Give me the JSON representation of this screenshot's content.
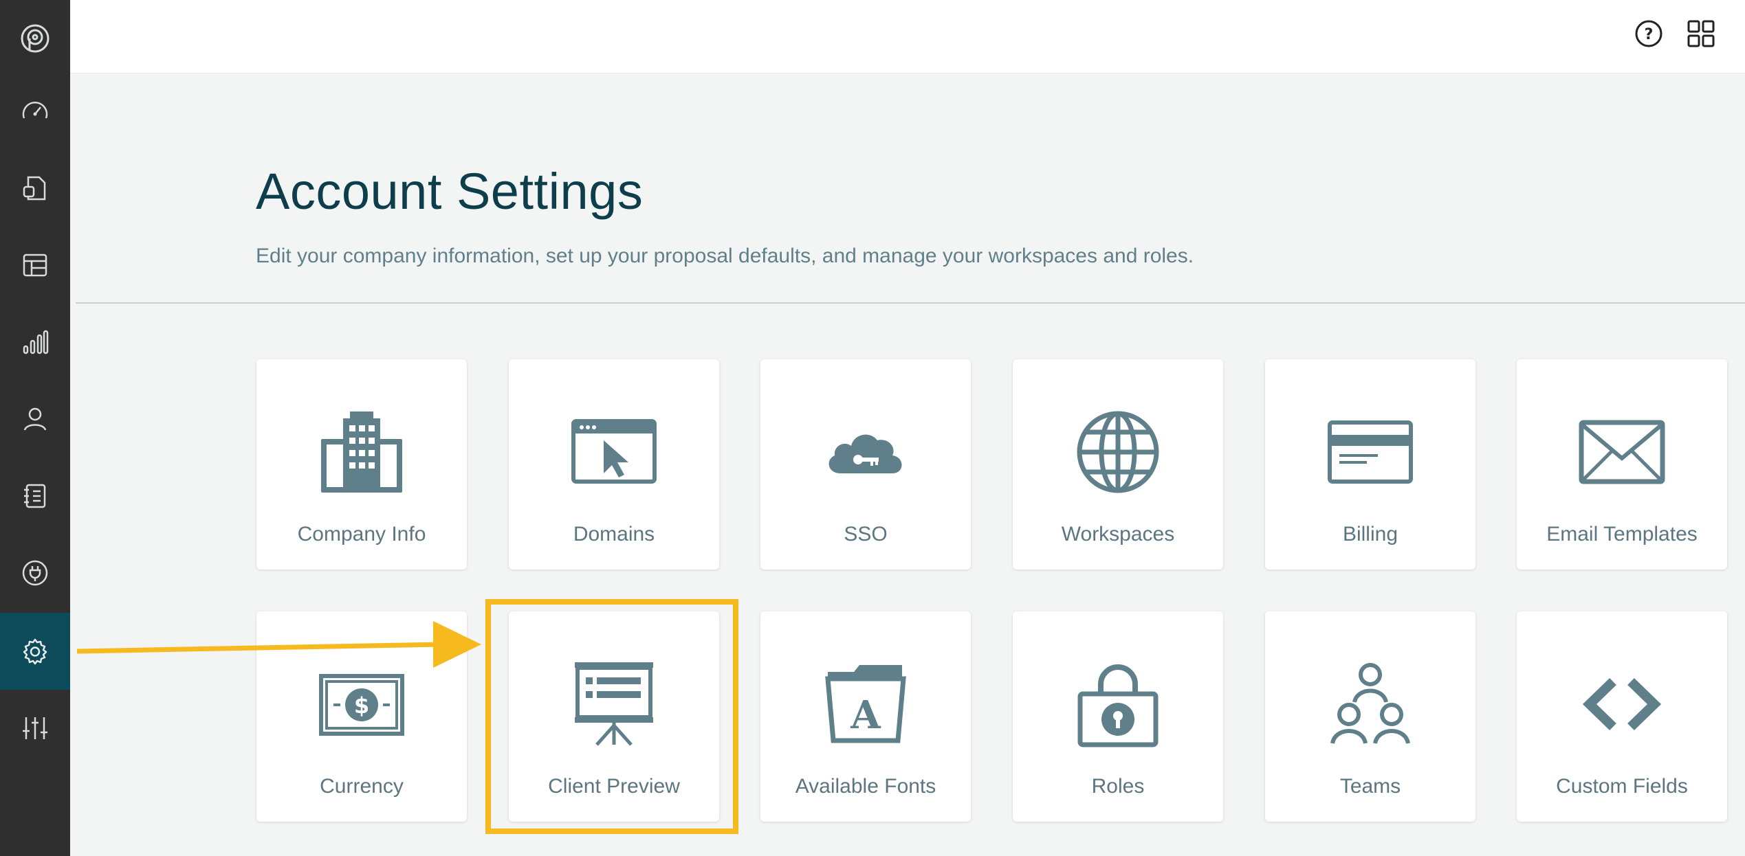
{
  "sidebar": {
    "items": [
      {
        "icon": "proposify-logo-icon"
      },
      {
        "icon": "dashboard-gauge-icon"
      },
      {
        "icon": "documents-icon"
      },
      {
        "icon": "templates-icon"
      },
      {
        "icon": "reports-bar-icon"
      },
      {
        "icon": "contacts-person-icon"
      },
      {
        "icon": "content-library-icon"
      },
      {
        "icon": "integrations-plug-icon"
      },
      {
        "icon": "settings-gear-icon",
        "active": true
      },
      {
        "icon": "sliders-icon"
      }
    ]
  },
  "header": {
    "icons": [
      "help-icon",
      "apps-grid-icon"
    ]
  },
  "main": {
    "title": "Account Settings",
    "subtitle": "Edit your company information, set up your proposal defaults, and manage your workspaces and roles."
  },
  "tiles": [
    {
      "label": "Company Info",
      "icon": "building-icon"
    },
    {
      "label": "Domains",
      "icon": "browser-cursor-icon"
    },
    {
      "label": "SSO",
      "icon": "cloud-key-icon"
    },
    {
      "label": "Workspaces",
      "icon": "globe-icon"
    },
    {
      "label": "Billing",
      "icon": "credit-card-icon"
    },
    {
      "label": "Email Templates",
      "icon": "envelope-icon"
    },
    {
      "label": "Currency",
      "icon": "dollar-bill-icon"
    },
    {
      "label": "Client Preview",
      "icon": "presentation-board-icon"
    },
    {
      "label": "Available Fonts",
      "icon": "font-folder-icon"
    },
    {
      "label": "Roles",
      "icon": "padlock-icon"
    },
    {
      "label": "Teams",
      "icon": "team-people-icon"
    },
    {
      "label": "Custom Fields",
      "icon": "code-brackets-icon"
    }
  ],
  "colors": {
    "sidebar_bg": "#2f2f2f",
    "sidebar_active": "#0d4b5b",
    "icon_color": "#5f7f8a",
    "title_color": "#0e3d4c",
    "highlight": "#f6b91e"
  },
  "annotation": {
    "highlighted_tile": "Client Preview"
  }
}
